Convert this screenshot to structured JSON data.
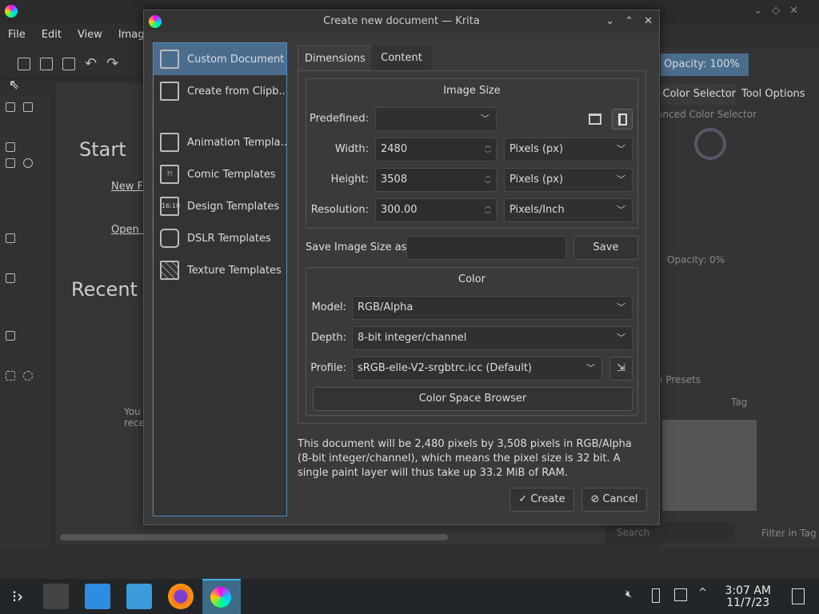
{
  "app": {
    "menu": [
      "File",
      "Edit",
      "View",
      "Image"
    ],
    "start_title": "Start",
    "new_file": "New File",
    "open_file": "Open File",
    "recent_title": "Recent Documents",
    "recent_hint": "You don't have any recent documents"
  },
  "right_panel": {
    "opacity": "Opacity: 100%",
    "tabs": [
      "Advanced Color Selector",
      "Tool Options"
    ],
    "color_selector_title": "Advanced Color Selector",
    "layers_opacity": "Opacity:  0%",
    "presets_title": "Brush Presets",
    "tag_label": "Tag",
    "search_placeholder": "Search",
    "filter_in_tag": "Filter in Tag"
  },
  "dialog": {
    "title": "Create new document — Krita",
    "templates": [
      {
        "label": "Custom Document",
        "icon": "document-icon"
      },
      {
        "label": "Create from Clipb...",
        "icon": "clipboard-new-icon"
      },
      {
        "label": "Animation Templa...",
        "icon": "animation-icon"
      },
      {
        "label": "Comic Templates",
        "icon": "comic-icon"
      },
      {
        "label": "Design Templates",
        "icon": "design-icon",
        "glyph": "16:10"
      },
      {
        "label": "DSLR Templates",
        "icon": "camera-icon"
      },
      {
        "label": "Texture Templates",
        "icon": "texture-icon"
      }
    ],
    "tabs": [
      "Dimensions",
      "Content"
    ],
    "image_size": {
      "title": "Image Size",
      "predefined_label": "Predefined:",
      "predefined_value": "",
      "width_label": "Width:",
      "width": "2480",
      "width_unit": "Pixels (px)",
      "height_label": "Height:",
      "height": "3508",
      "height_unit": "Pixels (px)",
      "resolution_label": "Resolution:",
      "resolution": "300.00",
      "resolution_unit": "Pixels/Inch",
      "orientation": "portrait"
    },
    "save_size_label": "Save Image Size as:",
    "save_size_value": "",
    "save_button": "Save",
    "color": {
      "title": "Color",
      "model_label": "Model:",
      "model": "RGB/Alpha",
      "depth_label": "Depth:",
      "depth": "8-bit integer/channel",
      "profile_label": "Profile:",
      "profile": "sRGB-elle-V2-srgbtrc.icc (Default)",
      "browser_button": "Color Space Browser"
    },
    "description": "This document will be 2,480 pixels by 3,508 pixels in RGB/Alpha (8-bit integer/channel), which means the pixel size is 32 bit. A single paint layer will thus take up 33.2 MiB of RAM.",
    "create_button": "Create",
    "cancel_button": "Cancel"
  },
  "taskbar": {
    "time": "3:07 AM",
    "date": "11/7/23"
  },
  "colors": {
    "accent": "#4a6d8e",
    "focus_border": "#4f8ec0",
    "taskbar": "#232629"
  }
}
